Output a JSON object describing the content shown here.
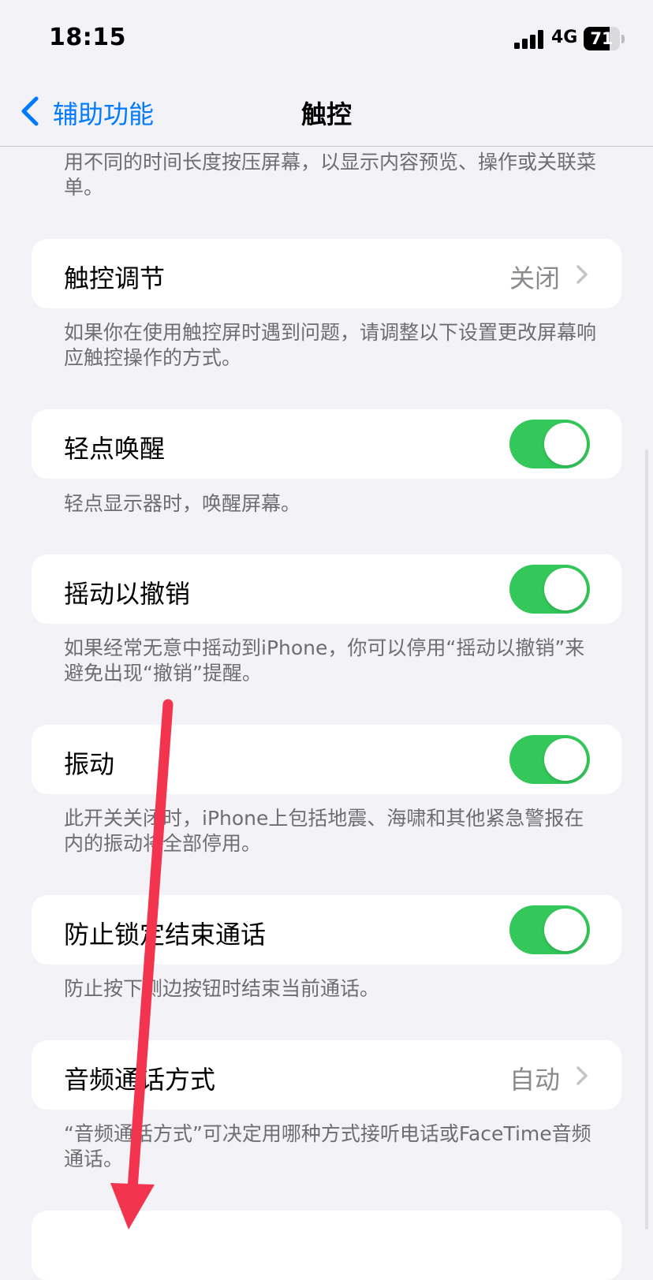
{
  "status_bar": {
    "time": "18:15",
    "network": "4G",
    "battery": "71",
    "battery_level": 0.71
  },
  "nav": {
    "back_label": "辅助功能",
    "title": "触控"
  },
  "sections": [
    {
      "footnote": "用不同的时间长度按压屏幕，以显示内容预览、操作或关联菜单。"
    },
    {
      "label": "触控调节",
      "value": "关闭",
      "type": "disclosure",
      "footnote": "如果你在使用触控屏时遇到问题，请调整以下设置更改屏幕响应触控操作的方式。"
    },
    {
      "label": "轻点唤醒",
      "type": "toggle",
      "on": true,
      "footnote": "轻点显示器时，唤醒屏幕。"
    },
    {
      "label": "摇动以撤销",
      "type": "toggle",
      "on": true,
      "footnote": "如果经常无意中摇动到iPhone，你可以停用“摇动以撤销”来避免出现“撤销”提醒。"
    },
    {
      "label": "振动",
      "type": "toggle",
      "on": true,
      "footnote": "此开关关闭时，iPhone上包括地震、海啸和其他紧急警报在内的振动将全部停用。"
    },
    {
      "label": "防止锁定结束通话",
      "type": "toggle",
      "on": true,
      "footnote": "防止按下侧边按钮时结束当前通话。"
    },
    {
      "label": "音频通话方式",
      "value": "自动",
      "type": "disclosure",
      "footnote": "“音频通话方式”可决定用哪种方式接听电话或FaceTime音频通话。"
    }
  ],
  "colors": {
    "accent": "#007aff",
    "toggle_on": "#34c759",
    "annotation_arrow": "#f2344f",
    "background": "#f2f2f7"
  },
  "icons": {
    "back": "chevron-left-icon",
    "disclosure": "chevron-right-icon"
  }
}
